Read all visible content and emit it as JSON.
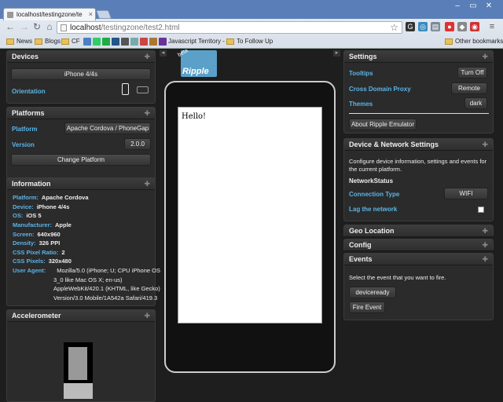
{
  "browser": {
    "tab_title": "localhost/testingzone/te",
    "url_host": "localhost",
    "url_path": "/testingzone/test2.html",
    "bookmarks": [
      "News",
      "Blogs",
      "CF",
      "Javascript Territory -",
      "To Follow Up"
    ],
    "other_bookmarks": "Other bookmarks"
  },
  "devices": {
    "title": "Devices",
    "device_button": "iPhone 4/4s",
    "orientation_label": "Orientation"
  },
  "platforms": {
    "title": "Platforms",
    "platform_label": "Platform",
    "platform_value": "Apache Cordova / PhoneGap",
    "version_label": "Version",
    "version_value": "2.0.0",
    "change_button": "Change Platform"
  },
  "information": {
    "title": "Information",
    "rows": [
      {
        "k": "Platform:",
        "v": "Apache Cordova"
      },
      {
        "k": "Device:",
        "v": "iPhone 4/4s"
      },
      {
        "k": "OS:",
        "v": "iOS 5"
      },
      {
        "k": "Manufacturer:",
        "v": "Apple"
      },
      {
        "k": "Screen:",
        "v": "640x960"
      },
      {
        "k": "Density:",
        "v": "326 PPI"
      },
      {
        "k": "CSS Pixel Ratio:",
        "v": "2"
      },
      {
        "k": "CSS Pixels:",
        "v": "320x480"
      },
      {
        "k": "User Agent:",
        "v": "Mozilla/5.0 (iPhone; U; CPU iPhone OS"
      }
    ],
    "ua_lines": [
      "3_0 like Mac OS X; en-us)",
      "AppleWebKit/420.1 (KHTML, like Gecko)",
      "Version/3.0 Mobile/1A542a Safari/419.3"
    ]
  },
  "accelerometer": {
    "title": "Accelerometer"
  },
  "device_screen": {
    "text": "Hello!"
  },
  "logo": {
    "text": "Ripple",
    "badge": "beta"
  },
  "settings": {
    "title": "Settings",
    "tooltips_label": "Tooltips",
    "tooltips_button": "Turn Off",
    "proxy_label": "Cross Domain Proxy",
    "proxy_button": "Remote",
    "themes_label": "Themes",
    "themes_button": "dark",
    "about_button": "About Ripple Emulator"
  },
  "network": {
    "title": "Device & Network Settings",
    "description": [
      "Configure device information, settings and events for",
      "the current platform."
    ],
    "section": "NetworkStatus",
    "connection_label": "Connection Type",
    "connection_value": "WIFI",
    "lag_label": "Lag the network"
  },
  "geo": {
    "title": "Geo Location"
  },
  "config": {
    "title": "Config"
  },
  "events": {
    "title": "Events",
    "description": "Select the event that you want to fire.",
    "event_value": "deviceready",
    "fire_button": "Fire Event"
  }
}
